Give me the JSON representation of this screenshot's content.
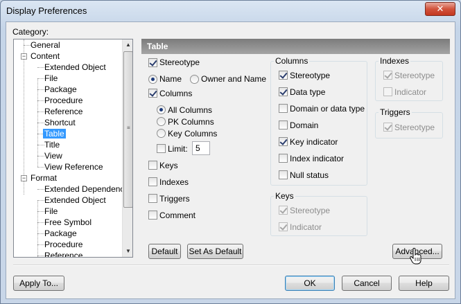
{
  "window": {
    "title": "Display Preferences",
    "close_glyph": "✕"
  },
  "category": {
    "label": "Category:",
    "items": [
      {
        "label": "General"
      },
      {
        "label": "Content"
      },
      {
        "label": "Extended Object"
      },
      {
        "label": "File"
      },
      {
        "label": "Package"
      },
      {
        "label": "Procedure"
      },
      {
        "label": "Reference"
      },
      {
        "label": "Shortcut"
      },
      {
        "label": "Table"
      },
      {
        "label": "Title"
      },
      {
        "label": "View"
      },
      {
        "label": "View Reference"
      },
      {
        "label": "Format"
      },
      {
        "label": "Extended Dependency"
      },
      {
        "label": "Extended Object"
      },
      {
        "label": "File"
      },
      {
        "label": "Free Symbol"
      },
      {
        "label": "Package"
      },
      {
        "label": "Procedure"
      },
      {
        "label": "Reference"
      }
    ],
    "expander_minus": "−",
    "scroll_up": "▲",
    "scroll_down": "▼",
    "grip": "≡"
  },
  "panel": {
    "title": "Table",
    "stereotype": "Stereotype",
    "name_radio": "Name",
    "owner_and_name_radio": "Owner and Name",
    "columns": "Columns",
    "all_columns": "All Columns",
    "pk_columns": "PK Columns",
    "key_columns": "Key Columns",
    "limit": "Limit:",
    "limit_value": "5",
    "keys": "Keys",
    "indexes": "Indexes",
    "triggers": "Triggers",
    "comment": "Comment"
  },
  "columns_group": {
    "title": "Columns",
    "items": [
      {
        "label": "Stereotype",
        "checked": true
      },
      {
        "label": "Data type",
        "checked": true
      },
      {
        "label": "Domain or data type",
        "checked": false
      },
      {
        "label": "Domain",
        "checked": false
      },
      {
        "label": "Key indicator",
        "checked": true
      },
      {
        "label": "Index indicator",
        "checked": false
      },
      {
        "label": "Null status",
        "checked": false
      }
    ]
  },
  "keys_group": {
    "title": "Keys",
    "stereotype": "Stereotype",
    "indicator": "Indicator"
  },
  "indexes_group": {
    "title": "Indexes",
    "stereotype": "Stereotype",
    "indicator": "Indicator"
  },
  "triggers_group": {
    "title": "Triggers",
    "stereotype": "Stereotype"
  },
  "buttons": {
    "default": "Default",
    "set_as_default": "Set As Default",
    "advanced": "Advanced...",
    "apply_to": "Apply To...",
    "ok": "OK",
    "cancel": "Cancel",
    "help": "Help"
  }
}
